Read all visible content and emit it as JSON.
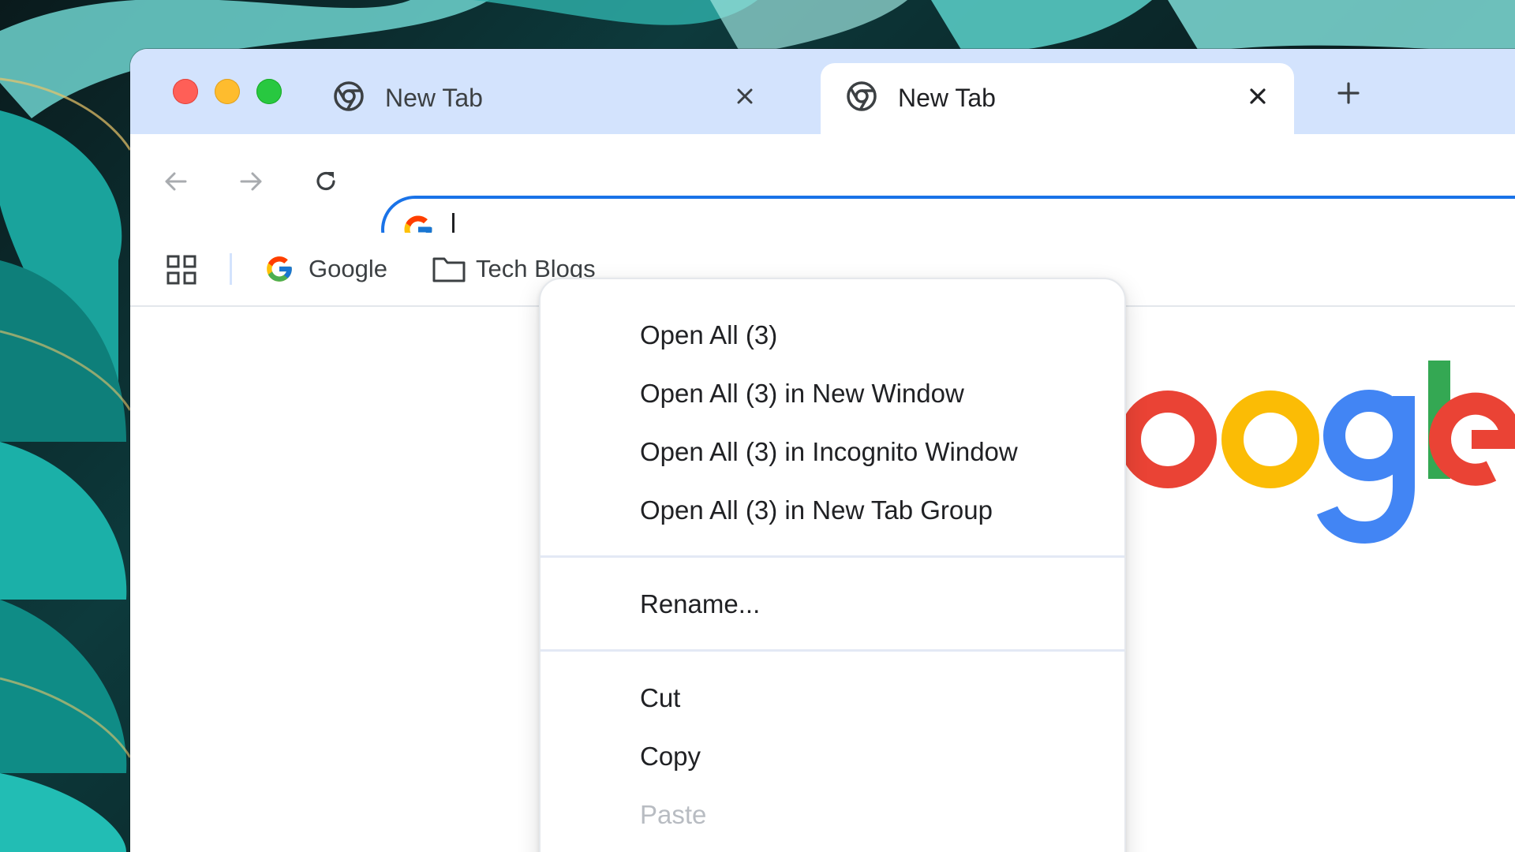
{
  "browser": {
    "tabs": [
      {
        "title": "New Tab",
        "active": false,
        "icon": "chrome-icon"
      },
      {
        "title": "New Tab",
        "active": true,
        "icon": "chrome-icon"
      }
    ],
    "new_tab_icon": "plus-icon"
  },
  "toolbar": {
    "back_icon": "arrow-left-icon",
    "forward_icon": "arrow-right-icon",
    "reload_icon": "reload-icon",
    "omnibox": {
      "value": "",
      "icon": "google-g-icon"
    }
  },
  "bookmarks": {
    "apps_icon": "apps-grid-icon",
    "items": [
      {
        "label": "Google",
        "icon": "google-g-icon"
      },
      {
        "label": "Tech Blogs",
        "icon": "folder-icon"
      }
    ]
  },
  "page": {
    "logo_text": "oogle"
  },
  "context_menu": {
    "groups": [
      [
        "Open All (3)",
        "Open All (3) in New Window",
        "Open All (3) in Incognito Window",
        "Open All (3) in New Tab Group"
      ],
      [
        "Rename..."
      ],
      [
        "Cut",
        "Copy",
        "Paste"
      ]
    ],
    "disabled": [
      "Paste"
    ]
  },
  "colors": {
    "tabstrip": "#d3e3fd",
    "omnibox_focus": "#1a73e8",
    "traffic_close": "#ff5f57",
    "traffic_minimize": "#febc2e",
    "traffic_maximize": "#28c840",
    "google_blue": "#4285f4",
    "google_red": "#ea4335",
    "google_yellow": "#fbbc05",
    "google_green": "#34a853"
  }
}
